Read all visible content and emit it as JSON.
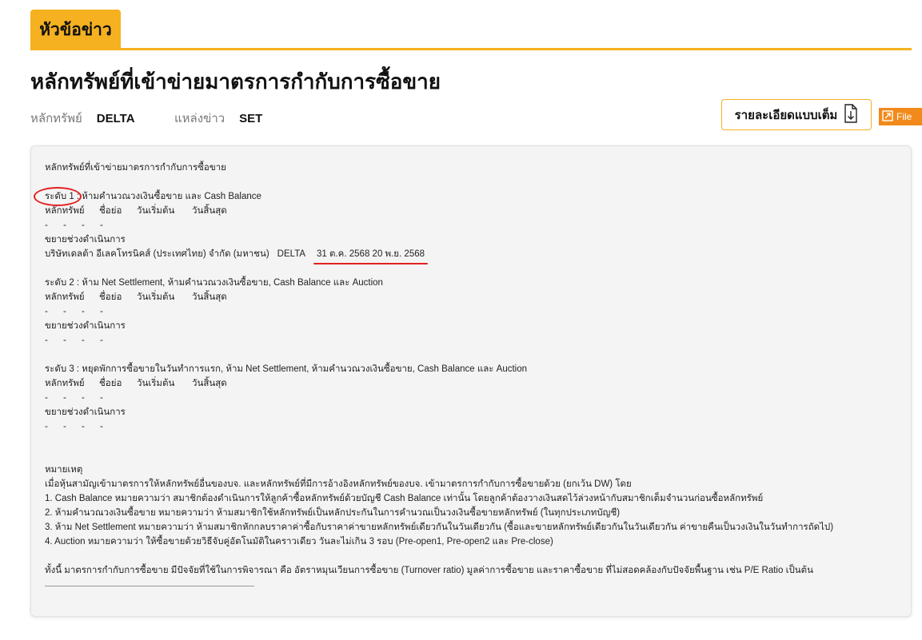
{
  "tab": {
    "label": "หัวข้อข่าว"
  },
  "title": "หลักทรัพย์ที่เข้าข่ายมาตรการกำกับการซื้อขาย",
  "meta": {
    "security_label": "หลักทรัพย์",
    "security_value": "DELTA",
    "source_label": "แหล่งข่าว",
    "source_value": "SET"
  },
  "actions": {
    "detail_label": "รายละเอียดแบบเต็ม",
    "file_label": "File"
  },
  "news": {
    "heading": "หลักทรัพย์ที่เข้าข่ายมาตรการกำกับการซื้อขาย",
    "columns": [
      "หลักทรัพย์",
      "ชื่อย่อ",
      "วันเริ่มต้น",
      "วันสิ้นสุด"
    ],
    "empty_mark": "-",
    "extended_label": "ขยายช่วงดำเนินการ",
    "levels": [
      {
        "title": "ระดับ 1 : ห้ามคำนวณวงเงินซื้อขาย และ Cash Balance",
        "extended": {
          "company": "บริษัทเดลต้า อีเลคโทรนิคส์ (ประเทศไทย) จำกัด (มหาชน)",
          "symbol": "DELTA",
          "dates": "31 ต.ค. 2568 20 พ.ย. 2568"
        }
      },
      {
        "title": "ระดับ 2 : ห้าม Net Settlement, ห้ามคำนวณวงเงินซื้อขาย, Cash Balance และ Auction"
      },
      {
        "title": "ระดับ 3 : หยุดพักการซื้อขายในวันทำการแรก, ห้าม Net Settlement, ห้ามคำนวณวงเงินซื้อขาย, Cash Balance และ Auction"
      }
    ],
    "remarks": {
      "heading": "หมายเหตุ",
      "intro": "เมื่อหุ้นสามัญเข้ามาตรการให้หลักทรัพย์อื่นของบจ. และหลักทรัพย์ที่มีการอ้างอิงหลักทรัพย์ของบจ. เข้ามาตรการกำกับการซื้อขายด้วย (ยกเว้น DW) โดย",
      "items": [
        "1. Cash Balance หมายความว่า สมาชิกต้องดำเนินการให้ลูกค้าซื้อหลักทรัพย์ด้วยบัญชี Cash Balance เท่านั้น โดยลูกค้าต้องวางเงินสดไว้ล่วงหน้ากับสมาชิกเต็มจำนวนก่อนซื้อหลักทรัพย์",
        "2. ห้ามคำนวณวงเงินซื้อขาย หมายความว่า ห้ามสมาชิกใช้หลักทรัพย์เป็นหลักประกันในการคำนวณเป็นวงเงินซื้อขายหลักทรัพย์ (ในทุกประเภทบัญชี)",
        "3. ห้าม Net Settlement หมายความว่า ห้ามสมาชิกหักกลบราคาค่าซื้อกับราคาค่าขายหลักทรัพย์เดียวกันในวันเดียวกัน (ซื้อและขายหลักทรัพย์เดียวกันในวันเดียวกัน ค่าขายคืนเป็นวงเงินในวันทำการถัดไป)",
        "4. Auction หมายความว่า ให้ซื้อขายด้วยวิธีจับคู่อัตโนมัติในคราวเดียว วันละไม่เกิน 3 รอบ (Pre-open1, Pre-open2 และ Pre-close)"
      ],
      "closing": "ทั้งนี้ มาตรการกำกับการซื้อขาย มีปัจจัยที่ใช้ในการพิจารณา คือ  อัตราหมุนเวียนการซื้อขาย (Turnover ratio) มูลค่าการซื้อขาย และราคาซื้อขาย ที่ไม่สอดคล้องกับปัจจัยพื้นฐาน เช่น P/E Ratio เป็นต้น"
    }
  },
  "icons": {
    "detail": "document-download-icon",
    "file": "file-icon"
  },
  "colors": {
    "accent": "#f5b120",
    "file_button": "#f28a1b",
    "annotation": "#e32020",
    "panel": "#f4f4f4"
  }
}
